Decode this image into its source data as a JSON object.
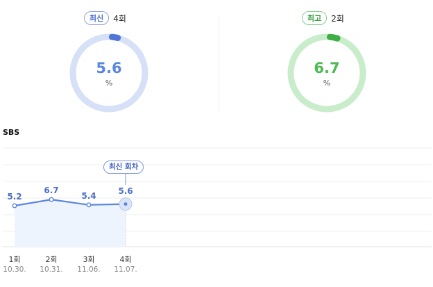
{
  "summary": {
    "latest": {
      "badge": "최신",
      "episode": "4회",
      "value": "5.6",
      "unit": "%",
      "color": "#5b86e0",
      "track": "#d6e0f6"
    },
    "highest": {
      "badge": "최고",
      "episode": "2회",
      "value": "6.7",
      "unit": "%",
      "color": "#4cba52",
      "track": "#c9ecca"
    }
  },
  "station": "SBS",
  "latest_tag": "최신 회차",
  "chart_data": {
    "type": "area",
    "title": "",
    "categories": [
      "1회",
      "2회",
      "3회",
      "4회"
    ],
    "dates": [
      "10.30.",
      "10.31.",
      "11.06.",
      "11.07."
    ],
    "series": [
      {
        "values": [
          5.2,
          6.7,
          5.4,
          5.6
        ],
        "data_labels": [
          "5.2",
          "6.7",
          "5.4",
          "5.6"
        ]
      }
    ],
    "grid": true,
    "colors": {
      "line": "#5b86e0",
      "fill": "#eef4fd",
      "label": "#4a6fc8"
    }
  }
}
